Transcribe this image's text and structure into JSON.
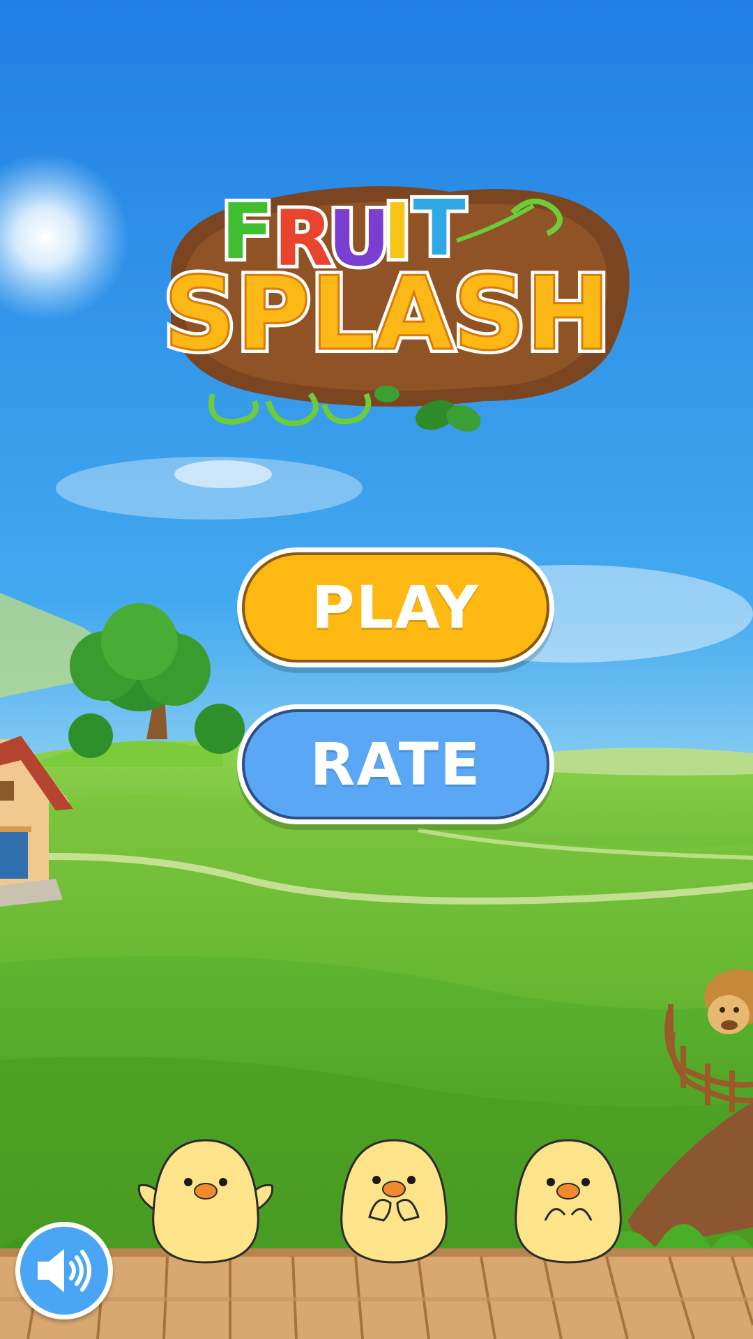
{
  "title": {
    "line1": "FRUIT",
    "line2": "SPLASH",
    "letters_line1": [
      {
        "char": "F",
        "color": "#3fbf2f"
      },
      {
        "char": "R",
        "color": "#e8442e"
      },
      {
        "char": "U",
        "color": "#7a3fd0"
      },
      {
        "char": "I",
        "color": "#f5c518"
      },
      {
        "char": "T",
        "color": "#2fa8e8"
      }
    ],
    "line2_color": "#fbb817"
  },
  "menu": {
    "play_label": "PLAY",
    "rate_label": "RATE"
  },
  "colors": {
    "play_button": "#fdb812",
    "rate_button": "#5aa8f5",
    "sky_top": "#2a87e6",
    "grass": "#6cc13a"
  },
  "icons": {
    "sound": "speaker-on-icon"
  }
}
